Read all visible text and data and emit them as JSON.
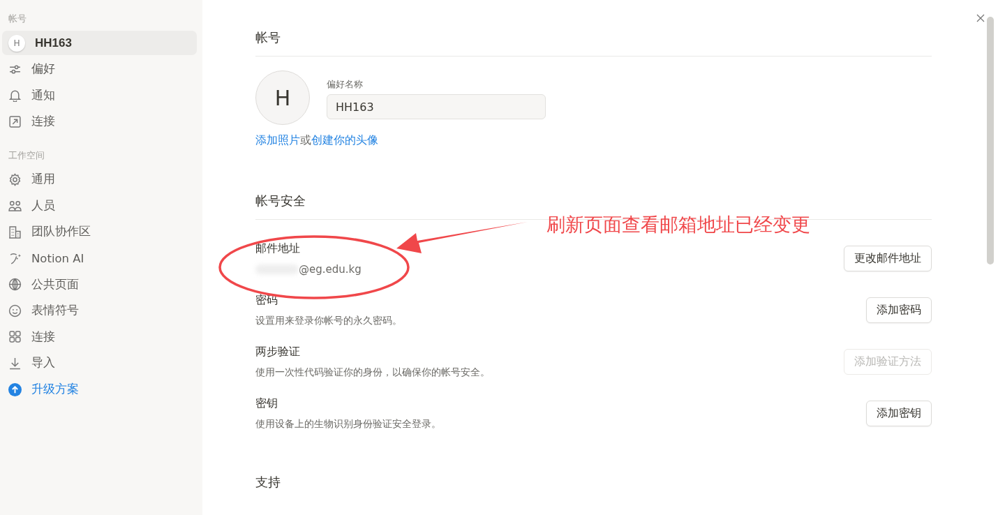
{
  "sidebar": {
    "sections": [
      {
        "heading": "帐号",
        "items": [
          {
            "label": "HH163",
            "avatar": "H",
            "selected": true,
            "accent": false
          },
          {
            "label": "偏好",
            "selected": false,
            "accent": false
          },
          {
            "label": "通知",
            "selected": false,
            "accent": false
          },
          {
            "label": "连接",
            "selected": false,
            "accent": false
          }
        ]
      },
      {
        "heading": "工作空间",
        "items": [
          {
            "label": "通用",
            "selected": false,
            "accent": false
          },
          {
            "label": "人员",
            "selected": false,
            "accent": false
          },
          {
            "label": "团队协作区",
            "selected": false,
            "accent": false
          },
          {
            "label": "Notion AI",
            "selected": false,
            "accent": false
          },
          {
            "label": "公共页面",
            "selected": false,
            "accent": false
          },
          {
            "label": "表情符号",
            "selected": false,
            "accent": false
          },
          {
            "label": "连接",
            "selected": false,
            "accent": false
          },
          {
            "label": "导入",
            "selected": false,
            "accent": false
          },
          {
            "label": "升级方案",
            "selected": false,
            "accent": true
          }
        ]
      }
    ]
  },
  "account": {
    "heading": "帐号",
    "avatar": "H",
    "name_label": "偏好名称",
    "name_value": "HH163",
    "photo_link": "添加照片",
    "photo_or": "或",
    "avatar_link": "创建你的头像"
  },
  "security": {
    "heading": "帐号安全",
    "rows": [
      {
        "title": "邮件地址",
        "detail": "@eg.edu.kg",
        "detail_blurred": true,
        "button": "更改邮件地址",
        "disabled": false
      },
      {
        "title": "密码",
        "detail": "设置用来登录你帐号的永久密码。",
        "detail_blurred": false,
        "button": "添加密码",
        "disabled": false
      },
      {
        "title": "两步验证",
        "detail": "使用一次性代码验证你的身份，以确保你的帐号安全。",
        "detail_blurred": false,
        "button": "添加验证方法",
        "disabled": true
      },
      {
        "title": "密钥",
        "detail": "使用设备上的生物识别身份验证安全登录。",
        "detail_blurred": false,
        "button": "添加密钥",
        "disabled": false
      }
    ]
  },
  "support": {
    "heading": "支持"
  },
  "annotation": {
    "text": "刷新页面查看邮箱地址已经变更"
  }
}
